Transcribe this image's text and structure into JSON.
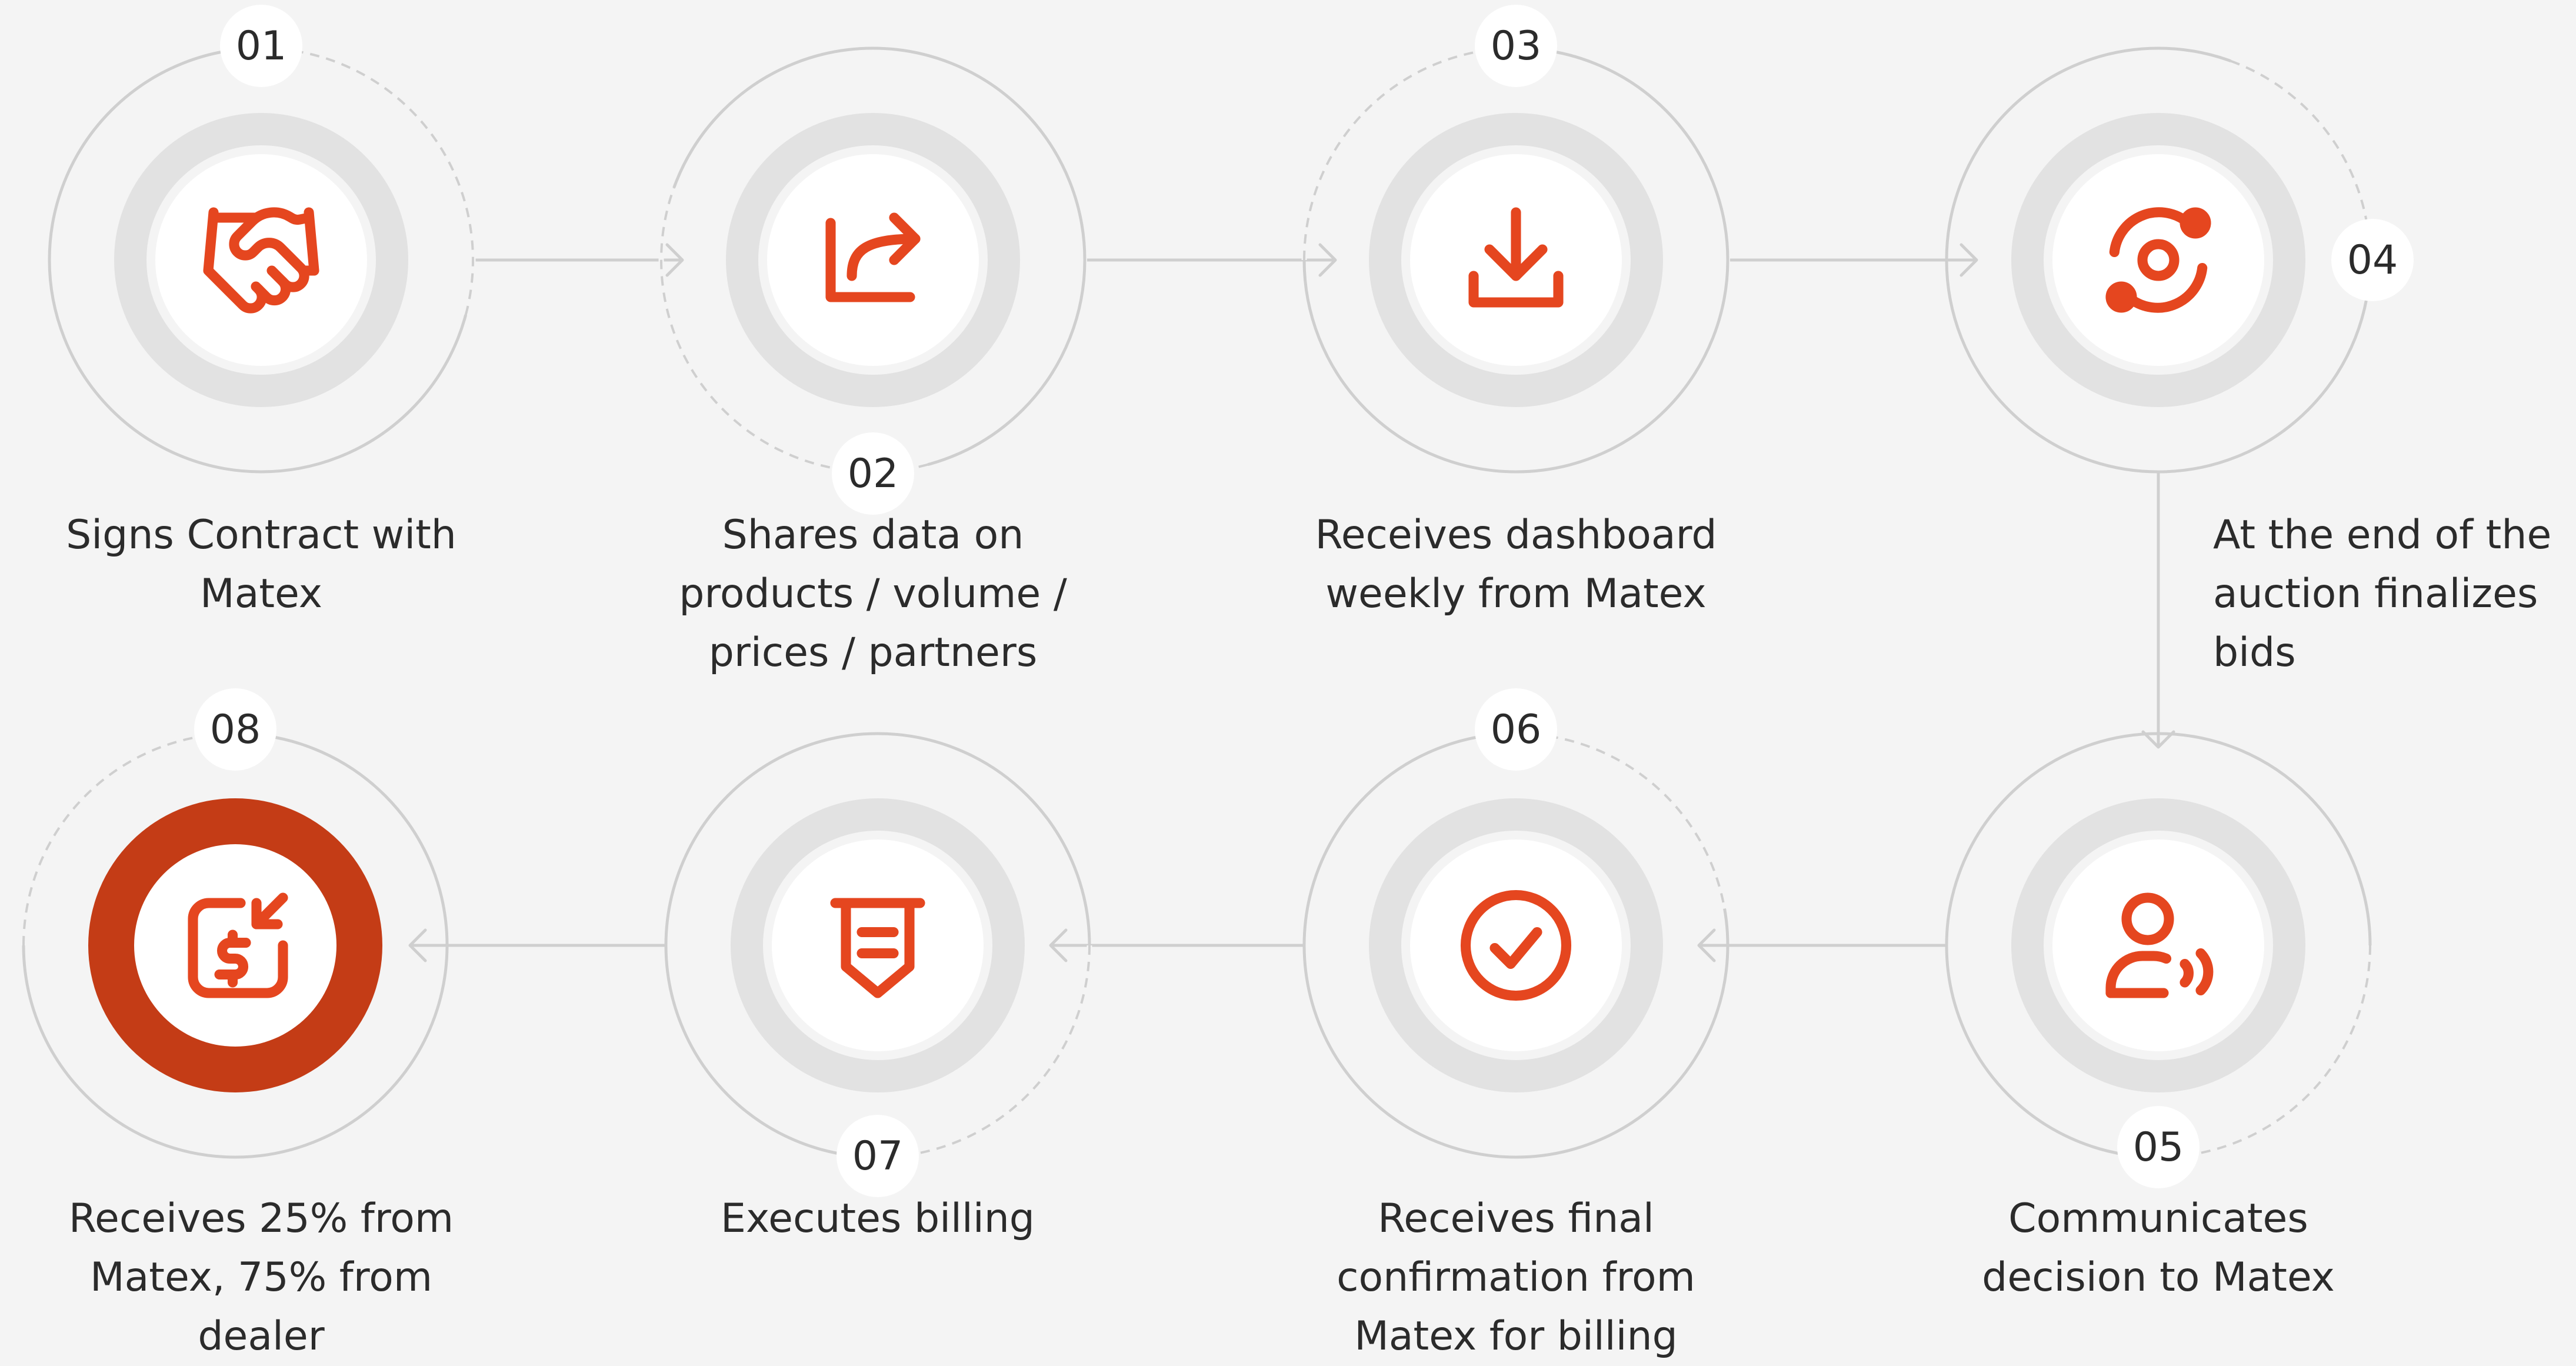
{
  "colors": {
    "background": "#f4f4f4",
    "accent": "#e5461f",
    "accent_dark": "#c43c16",
    "ring": "#e2e2e2",
    "line": "#cfcfcf"
  },
  "steps": [
    {
      "number": "01",
      "label": "Signs Contract with\nMatex",
      "icon": "handshake-icon",
      "highlighted": false
    },
    {
      "number": "02",
      "label": "Shares data on\nproducts / volume /\nprices / partners",
      "icon": "share-arrow-icon",
      "highlighted": false
    },
    {
      "number": "03",
      "label": "Receives dashboard\nweekly from Matex",
      "icon": "download-icon",
      "highlighted": false
    },
    {
      "number": "04",
      "label": "At the end of the\nauction finalizes\nbids",
      "icon": "orbit-icon",
      "highlighted": false
    },
    {
      "number": "05",
      "label": "Communicates\ndecision to Matex",
      "icon": "user-voice-icon",
      "highlighted": false
    },
    {
      "number": "06",
      "label": "Receives final\nconfirmation from\nMatex for billing",
      "icon": "check-circle-icon",
      "highlighted": false
    },
    {
      "number": "07",
      "label": "Executes billing",
      "icon": "receipt-icon",
      "highlighted": false
    },
    {
      "number": "08",
      "label": "Receives 25% from\nMatex, 75% from\ndealer",
      "icon": "payment-in-icon",
      "highlighted": true
    }
  ]
}
